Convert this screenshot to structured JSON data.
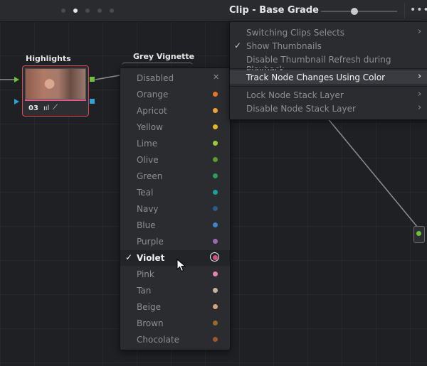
{
  "header": {
    "clip_title": "Clip - Base Grade",
    "page_dot_active_index": 1,
    "slider_value_fraction": 0.45
  },
  "nodes": {
    "highlights": {
      "label": "Highlights",
      "number": "03",
      "ring_color": "#d94a4a",
      "tag_color": "#e05a8a"
    },
    "grey_vignette": {
      "label": "Grey Vignette"
    }
  },
  "color_menu": {
    "items": [
      {
        "label": "Disabled",
        "color": "",
        "icon": "x-icon"
      },
      {
        "label": "Orange",
        "color": "#e8742a"
      },
      {
        "label": "Apricot",
        "color": "#f2a03a"
      },
      {
        "label": "Yellow",
        "color": "#e2b920"
      },
      {
        "label": "Lime",
        "color": "#9cc93a"
      },
      {
        "label": "Olive",
        "color": "#5f9c2b"
      },
      {
        "label": "Green",
        "color": "#2f9a5a"
      },
      {
        "label": "Teal",
        "color": "#1aa09d"
      },
      {
        "label": "Navy",
        "color": "#2a5d86"
      },
      {
        "label": "Blue",
        "color": "#3d86c7"
      },
      {
        "label": "Purple",
        "color": "#9a6ab3"
      },
      {
        "label": "Violet",
        "color": "#d64c8b",
        "selected": true
      },
      {
        "label": "Pink",
        "color": "#e583ae"
      },
      {
        "label": "Tan",
        "color": "#c8b3a0"
      },
      {
        "label": "Beige",
        "color": "#d1a47a"
      },
      {
        "label": "Brown",
        "color": "#9a6a2c"
      },
      {
        "label": "Chocolate",
        "color": "#a0552c"
      }
    ]
  },
  "main_menu": {
    "items": [
      {
        "label": "Switching Clips Selects",
        "submenu": true
      },
      {
        "label": "Show Thumbnails",
        "checked": true
      },
      {
        "label": "Disable Thumbnail Refresh during Playback"
      },
      {
        "label": "Track Node Changes Using Color",
        "submenu": true,
        "highlighted": true
      },
      {
        "label": "Lock Node Stack Layer",
        "submenu": true
      },
      {
        "label": "Disable Node Stack Layer",
        "submenu": true
      }
    ]
  },
  "colors": {
    "background": "#1e1f22",
    "menu_bg": "#2b2c30",
    "connection_green": "#6cc23a",
    "connection_cyan": "#2aa3d6"
  }
}
